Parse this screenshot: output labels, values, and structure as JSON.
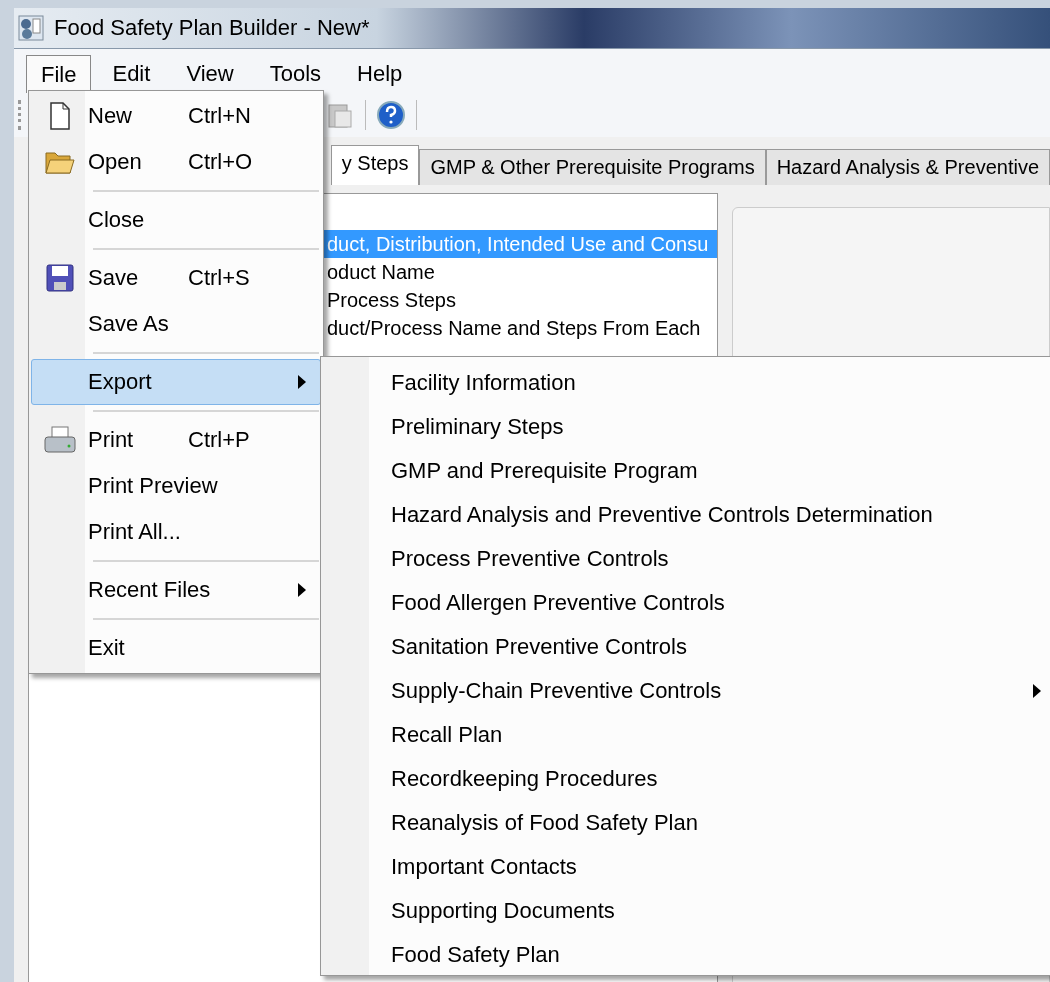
{
  "window": {
    "title": "Food Safety Plan Builder - New*"
  },
  "menubar": [
    {
      "label": "File",
      "selected": true
    },
    {
      "label": "Edit",
      "selected": false
    },
    {
      "label": "View",
      "selected": false
    },
    {
      "label": "Tools",
      "selected": false
    },
    {
      "label": "Help",
      "selected": false
    }
  ],
  "tabs": [
    {
      "label": "y Steps",
      "selected": true
    },
    {
      "label": "GMP & Other Prerequisite Programs",
      "selected": false
    },
    {
      "label": "Hazard Analysis & Preventive",
      "selected": false
    }
  ],
  "tree": {
    "items": [
      {
        "label": "duct, Distribution, Intended Use and Consu",
        "selected": true
      },
      {
        "label": "oduct Name",
        "selected": false
      },
      {
        "label": "Process Steps",
        "selected": false
      },
      {
        "label": "duct/Process Name and Steps From Each",
        "selected": false
      }
    ]
  },
  "file_menu": [
    {
      "kind": "item",
      "label": "New",
      "shortcut": "Ctrl+N",
      "selected": false
    },
    {
      "kind": "item",
      "label": "Open",
      "shortcut": "Ctrl+O",
      "selected": false
    },
    {
      "kind": "separator"
    },
    {
      "kind": "item",
      "label": "Close",
      "selected": false
    },
    {
      "kind": "separator"
    },
    {
      "kind": "item",
      "label": "Save",
      "shortcut": "Ctrl+S",
      "selected": false
    },
    {
      "kind": "item",
      "label": "Save As",
      "selected": false
    },
    {
      "kind": "separator"
    },
    {
      "kind": "submenu",
      "label": "Export",
      "selected": true
    },
    {
      "kind": "separator"
    },
    {
      "kind": "item",
      "label": "Print",
      "shortcut": "Ctrl+P",
      "selected": false
    },
    {
      "kind": "item",
      "label": "Print Preview",
      "selected": false
    },
    {
      "kind": "item",
      "label": "Print All...",
      "selected": false
    },
    {
      "kind": "separator"
    },
    {
      "kind": "submenu",
      "label": "Recent Files",
      "selected": false
    },
    {
      "kind": "separator"
    },
    {
      "kind": "item",
      "label": "Exit",
      "selected": false
    }
  ],
  "export_menu": [
    {
      "kind": "item",
      "label": "Facility Information"
    },
    {
      "kind": "item",
      "label": "Preliminary Steps"
    },
    {
      "kind": "item",
      "label": "GMP and Prerequisite Program"
    },
    {
      "kind": "item",
      "label": "Hazard Analysis and Preventive Controls Determination"
    },
    {
      "kind": "item",
      "label": "Process Preventive Controls"
    },
    {
      "kind": "item",
      "label": "Food Allergen Preventive Controls"
    },
    {
      "kind": "item",
      "label": "Sanitation Preventive Controls"
    },
    {
      "kind": "submenu",
      "label": "Supply-Chain Preventive Controls"
    },
    {
      "kind": "item",
      "label": "Recall Plan"
    },
    {
      "kind": "item",
      "label": "Recordkeeping Procedures"
    },
    {
      "kind": "item",
      "label": "Reanalysis of Food Safety Plan"
    },
    {
      "kind": "item",
      "label": "Important Contacts"
    },
    {
      "kind": "item",
      "label": "Supporting Documents"
    },
    {
      "kind": "item",
      "label": "Food Safety Plan"
    }
  ]
}
